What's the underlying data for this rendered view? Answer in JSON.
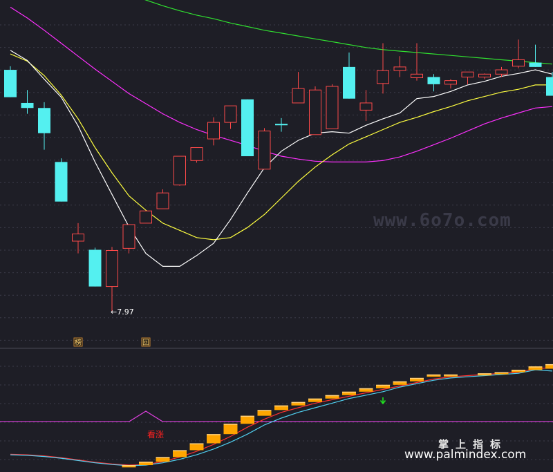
{
  "watermarks": {
    "site": "www.6o7o.com",
    "cn_title": "掌上指标",
    "url": "www.palmindex.com"
  },
  "chart_data": [
    {
      "type": "candlestick",
      "panel": "main",
      "ylim": [
        7.5,
        12.3
      ],
      "grid": true,
      "low_annotation": {
        "index": 6,
        "text": "←7.97",
        "value": 7.97
      },
      "markers": [
        {
          "index": 4,
          "text": "榜"
        },
        {
          "index": 8,
          "text": "回"
        }
      ],
      "colors": {
        "up": "#ff4a4a",
        "down": "#54f0f0",
        "ma5": "#ffffff",
        "ma10": "#ffff40",
        "ma20": "#ff30ff",
        "ma60": "#30e030"
      },
      "candles": [
        {
          "open": 11.33,
          "high": 11.38,
          "low": 10.95,
          "close": 10.95
        },
        {
          "open": 10.87,
          "high": 11.05,
          "low": 10.72,
          "close": 10.8
        },
        {
          "open": 10.8,
          "high": 10.88,
          "low": 10.22,
          "close": 10.45
        },
        {
          "open": 10.05,
          "high": 10.1,
          "low": 9.5,
          "close": 9.5
        },
        {
          "open": 8.95,
          "high": 9.2,
          "low": 8.78,
          "close": 9.05
        },
        {
          "open": 8.83,
          "high": 8.86,
          "low": 8.32,
          "close": 8.32
        },
        {
          "open": 8.32,
          "high": 8.87,
          "low": 7.97,
          "close": 8.82
        },
        {
          "open": 8.85,
          "high": 9.18,
          "low": 8.78,
          "close": 9.18
        },
        {
          "open": 9.2,
          "high": 9.37,
          "low": 9.2,
          "close": 9.37
        },
        {
          "open": 9.4,
          "high": 9.67,
          "low": 9.4,
          "close": 9.62
        },
        {
          "open": 9.73,
          "high": 10.13,
          "low": 9.72,
          "close": 10.13
        },
        {
          "open": 10.07,
          "high": 10.25,
          "low": 10.04,
          "close": 10.25
        },
        {
          "open": 10.37,
          "high": 10.67,
          "low": 10.28,
          "close": 10.6
        },
        {
          "open": 10.6,
          "high": 10.83,
          "low": 10.51,
          "close": 10.83
        },
        {
          "open": 10.92,
          "high": 10.92,
          "low": 10.13,
          "close": 10.13
        },
        {
          "open": 9.95,
          "high": 10.52,
          "low": 9.95,
          "close": 10.48
        },
        {
          "open": 10.58,
          "high": 10.66,
          "low": 10.47,
          "close": 10.56
        },
        {
          "open": 10.87,
          "high": 11.3,
          "low": 10.87,
          "close": 11.07
        },
        {
          "open": 10.43,
          "high": 11.1,
          "low": 10.43,
          "close": 11.05
        },
        {
          "open": 10.51,
          "high": 11.13,
          "low": 10.51,
          "close": 11.1
        },
        {
          "open": 11.37,
          "high": 11.57,
          "low": 10.93,
          "close": 10.93
        },
        {
          "open": 10.77,
          "high": 11.05,
          "low": 10.62,
          "close": 10.87
        },
        {
          "open": 11.14,
          "high": 11.7,
          "low": 11.0,
          "close": 11.32
        },
        {
          "open": 11.32,
          "high": 11.52,
          "low": 11.23,
          "close": 11.37
        },
        {
          "open": 11.22,
          "high": 11.7,
          "low": 11.18,
          "close": 11.27
        },
        {
          "open": 11.23,
          "high": 11.27,
          "low": 11.03,
          "close": 11.13
        },
        {
          "open": 11.13,
          "high": 11.2,
          "low": 11.07,
          "close": 11.18
        },
        {
          "open": 11.23,
          "high": 11.3,
          "low": 11.13,
          "close": 11.3
        },
        {
          "open": 11.23,
          "high": 11.28,
          "low": 11.2,
          "close": 11.27
        },
        {
          "open": 11.27,
          "high": 11.37,
          "low": 11.23,
          "close": 11.33
        },
        {
          "open": 11.38,
          "high": 11.75,
          "low": 11.35,
          "close": 11.47
        },
        {
          "open": 11.43,
          "high": 11.68,
          "low": 11.37,
          "close": 11.37
        },
        {
          "open": 11.23,
          "high": 11.3,
          "low": 10.97,
          "close": 10.97
        }
      ],
      "ma5": [
        11.6,
        11.46,
        11.2,
        10.95,
        10.55,
        10.05,
        9.6,
        9.15,
        8.78,
        8.6,
        8.6,
        8.75,
        8.92,
        9.25,
        9.62,
        9.97,
        10.2,
        10.35,
        10.45,
        10.47,
        10.45,
        10.56,
        10.65,
        10.73,
        10.93,
        10.96,
        11.03,
        11.12,
        11.17,
        11.24,
        11.28,
        11.33,
        11.27
      ],
      "ma10": [
        11.55,
        11.45,
        11.25,
        10.98,
        10.65,
        10.25,
        9.9,
        9.58,
        9.38,
        9.2,
        9.1,
        9.0,
        8.97,
        9.0,
        9.14,
        9.32,
        9.55,
        9.78,
        9.98,
        10.15,
        10.3,
        10.4,
        10.5,
        10.6,
        10.67,
        10.75,
        10.82,
        10.9,
        10.96,
        11.02,
        11.06,
        11.12,
        11.12
      ],
      "ma20": [
        12.2,
        12.05,
        11.88,
        11.7,
        11.52,
        11.34,
        11.17,
        11.0,
        10.86,
        10.72,
        10.6,
        10.5,
        10.42,
        10.35,
        10.28,
        10.2,
        10.13,
        10.09,
        10.06,
        10.05,
        10.05,
        10.05,
        10.07,
        10.12,
        10.2,
        10.29,
        10.38,
        10.48,
        10.58,
        10.66,
        10.73,
        10.8,
        10.82
      ],
      "ma60": [
        12.82,
        12.76,
        12.7,
        12.64,
        12.58,
        12.52,
        12.46,
        12.38,
        12.3,
        12.22,
        12.15,
        12.09,
        12.04,
        11.98,
        11.93,
        11.88,
        11.84,
        11.8,
        11.76,
        11.72,
        11.68,
        11.64,
        11.61,
        11.59,
        11.57,
        11.55,
        11.53,
        11.51,
        11.49,
        11.47,
        11.45,
        11.43,
        11.41
      ]
    },
    {
      "type": "bar",
      "panel": "indicator",
      "ylim": [
        0,
        100
      ],
      "grid": true,
      "label": {
        "index": 8,
        "text": "看涨"
      },
      "arrow": {
        "index": 22,
        "direction": "down"
      },
      "pulse": {
        "index": 8,
        "baseline": 41,
        "peak": 50
      },
      "bars": [
        {
          "low": 2,
          "high": 2
        },
        {
          "low": 2,
          "high": 2
        },
        {
          "low": 2,
          "high": 2
        },
        {
          "low": 2,
          "high": 2
        },
        {
          "low": 2,
          "high": 2
        },
        {
          "low": 2,
          "high": 2
        },
        {
          "low": 2,
          "high": 2
        },
        {
          "low": 1,
          "high": 3
        },
        {
          "low": 3,
          "high": 6
        },
        {
          "low": 6,
          "high": 10
        },
        {
          "low": 10,
          "high": 16
        },
        {
          "low": 16,
          "high": 22
        },
        {
          "low": 22,
          "high": 30
        },
        {
          "low": 30,
          "high": 39
        },
        {
          "low": 39,
          "high": 46
        },
        {
          "low": 46,
          "high": 51
        },
        {
          "low": 51,
          "high": 55
        },
        {
          "low": 55,
          "high": 58
        },
        {
          "low": 58,
          "high": 61
        },
        {
          "low": 61,
          "high": 64
        },
        {
          "low": 64,
          "high": 67
        },
        {
          "low": 67,
          "high": 70
        },
        {
          "low": 70,
          "high": 73
        },
        {
          "low": 73,
          "high": 76
        },
        {
          "low": 76,
          "high": 79
        },
        {
          "low": 80,
          "high": 82
        },
        {
          "low": 81,
          "high": 82
        },
        {
          "low": 82,
          "high": 82
        },
        {
          "low": 82,
          "high": 83
        },
        {
          "low": 83,
          "high": 84
        },
        {
          "low": 84,
          "high": 86
        },
        {
          "low": 86,
          "high": 89
        },
        {
          "low": 87,
          "high": 91
        }
      ],
      "line_cyan": [
        12,
        11.5,
        10.5,
        9,
        7,
        5,
        3.5,
        2.5,
        3,
        5,
        8,
        12,
        17,
        23,
        30,
        38,
        44,
        49,
        53,
        57,
        61,
        64,
        67,
        71,
        74,
        77,
        79,
        80,
        81,
        82,
        83,
        86,
        85
      ],
      "line_red": [
        12.5,
        12,
        11,
        9.5,
        7.5,
        5.5,
        4,
        3,
        3.5,
        6,
        10,
        15,
        21,
        28,
        36,
        43,
        49,
        53,
        57,
        60,
        63,
        66,
        69,
        72,
        75,
        78,
        80,
        81,
        82,
        83,
        84,
        87,
        88
      ],
      "colors": {
        "bar": "#ffa500",
        "bar_hi": "#ffd27f",
        "line_cyan": "#50d0f0",
        "line_red": "#ff3030",
        "pulse": "#e040e0",
        "label": "#ff2020",
        "arrow": "#20e020"
      }
    }
  ]
}
